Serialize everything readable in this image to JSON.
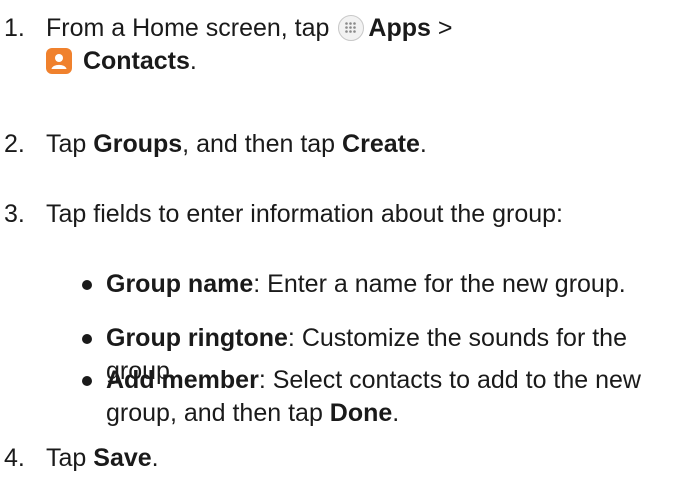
{
  "steps": [
    {
      "num": "1.",
      "t1": "From a Home screen, tap ",
      "b1": "Apps",
      "t2": " >",
      "b2": "Contacts",
      "t3": ".",
      "icon1": "apps-grid-icon",
      "icon2": "contacts-app-icon"
    },
    {
      "num": "2.",
      "t1": "Tap ",
      "b1": "Groups",
      "t2": ", and then tap ",
      "b2": "Create",
      "t3": "."
    },
    {
      "num": "3.",
      "t1": "Tap fields to enter information about the group:"
    },
    {
      "num": "4.",
      "t1": "Tap ",
      "b1": "Save",
      "t2": "."
    }
  ],
  "bullets": [
    {
      "b": "Group name",
      "t": ": Enter a name for the new group."
    },
    {
      "b": "Group ringtone",
      "t": ": Customize the sounds for the group."
    },
    {
      "b": "Add member",
      "t": ": Select contacts to add to the new group, and then tap ",
      "b2": "Done",
      "t2": "."
    }
  ],
  "colors": {
    "text": "#1a1a1a",
    "contacts_icon": "#f0812d",
    "apps_icon_bg": "#f2f2f2"
  }
}
